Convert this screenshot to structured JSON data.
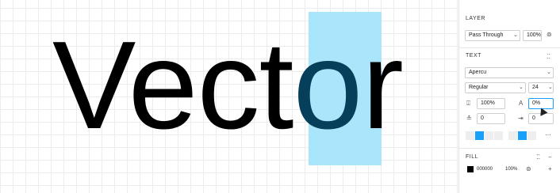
{
  "canvas": {
    "text_before": "Vect",
    "text_selected": "o",
    "text_after": "r"
  },
  "layer": {
    "title": "LAYER",
    "blend_mode": "Pass Through",
    "opacity": "100%"
  },
  "text_section": {
    "title": "TEXT",
    "font_family": "Apercu",
    "font_weight": "Regular",
    "font_size": "24",
    "line_height": "100%",
    "letter_spacing": "0%",
    "paragraph_spacing": "0",
    "paragraph_indent": "0"
  },
  "fill": {
    "title": "FILL",
    "hex": "000000",
    "opacity": "100%"
  },
  "colors": {
    "selection": "#a9e6fb",
    "selected_text": "#063f5a",
    "accent": "#18a0fb"
  }
}
